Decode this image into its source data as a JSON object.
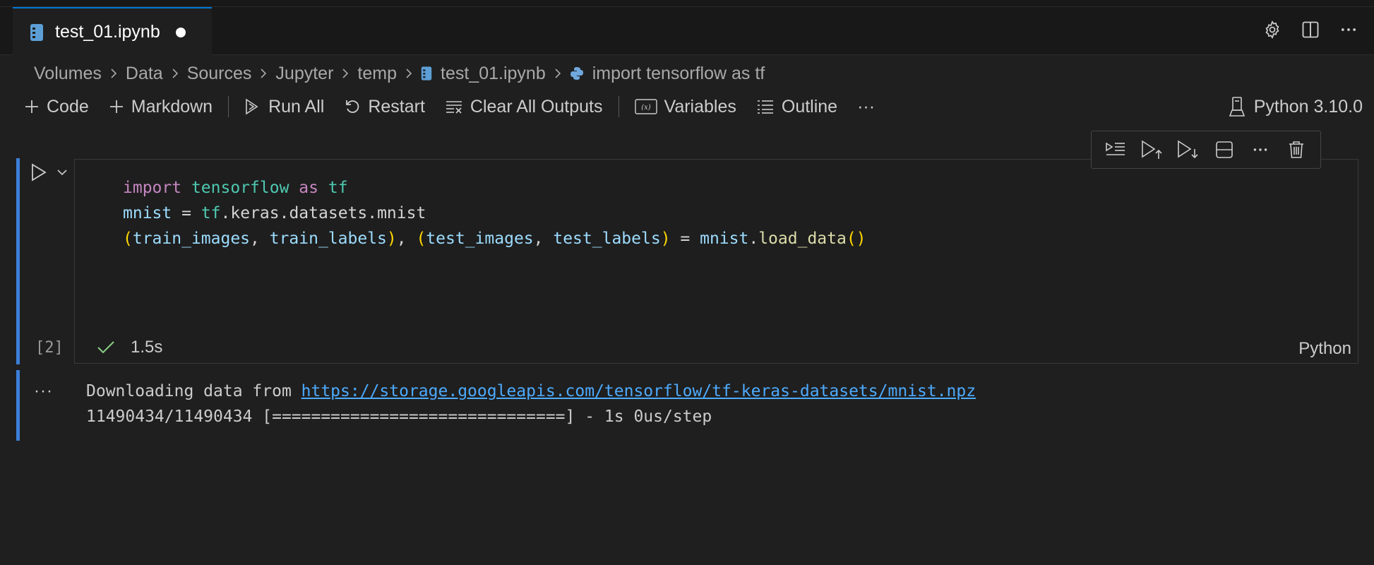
{
  "tab": {
    "label": "test_01.ipynb",
    "modified": true
  },
  "breadcrumb": [
    "Volumes",
    "Data",
    "Sources",
    "Jupyter",
    "temp",
    "test_01.ipynb",
    "import tensorflow as tf"
  ],
  "toolbar": {
    "code": "Code",
    "markdown": "Markdown",
    "run_all": "Run All",
    "restart": "Restart",
    "clear_outputs": "Clear All Outputs",
    "variables": "Variables",
    "outline": "Outline",
    "more": "···"
  },
  "kernel": {
    "label": "Python 3.10.0"
  },
  "cell": {
    "execution_count": "[2]",
    "duration": "1.5s",
    "language": "Python",
    "code_lines": [
      "import tensorflow as tf",
      "mnist = tf.keras.datasets.mnist",
      "(train_images, train_labels), (test_images, test_labels) = mnist.load_data()"
    ]
  },
  "output": {
    "more": "···",
    "prefix": "Downloading data from ",
    "url": "https://storage.googleapis.com/tensorflow/tf-keras-datasets/mnist.npz",
    "progress_line": "11490434/11490434 [==============================] - 1s 0us/step"
  },
  "colors": {
    "accent": "#3c7fd8",
    "link": "#4daafc",
    "background": "#1f1f1f"
  }
}
